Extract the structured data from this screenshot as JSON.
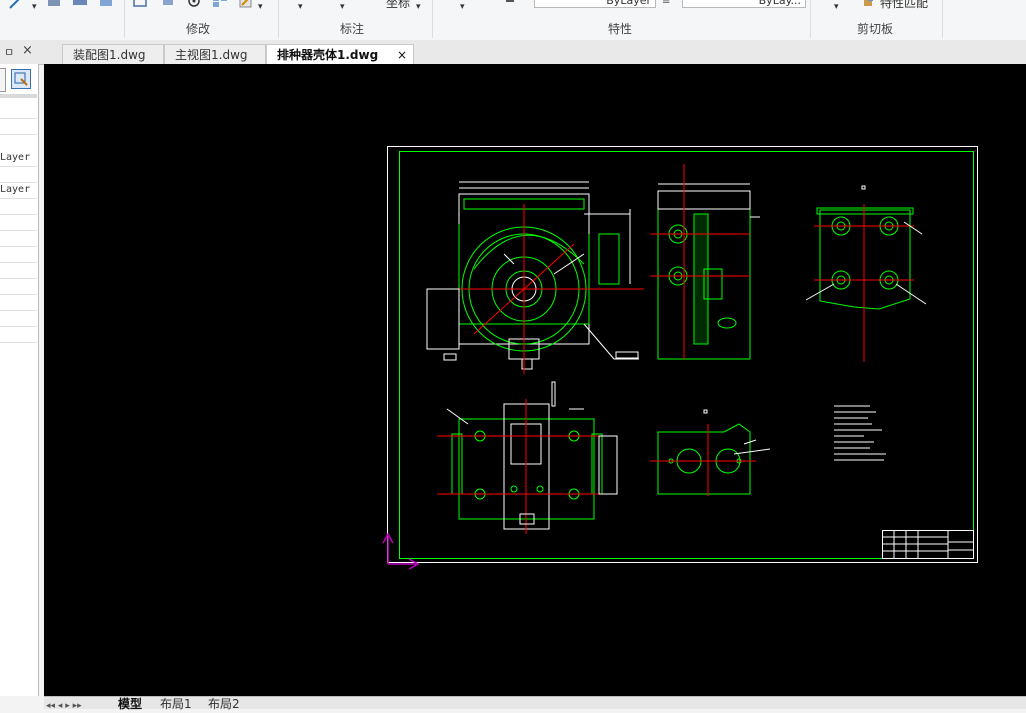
{
  "ribbon": {
    "groups": [
      {
        "label": "修改"
      },
      {
        "label": "标注"
      },
      {
        "label": "特性"
      },
      {
        "label": "剪切板"
      }
    ],
    "coord_label": "坐标",
    "layer_field_1": "ByLayer",
    "layer_field_2": "ByLay...",
    "match_label": "特性匹配"
  },
  "left_panel": {
    "pin_label": "ㅁ",
    "close_label": "×",
    "rows": [
      "",
      "",
      "Layer",
      "",
      "Layer",
      "",
      "",
      "",
      "",
      "",
      "",
      "",
      "",
      ""
    ]
  },
  "doc_tabs": [
    {
      "label": "装配图1.dwg",
      "active": false
    },
    {
      "label": "主视图1.dwg",
      "active": false
    },
    {
      "label": "排种器壳体1.dwg",
      "active": true
    }
  ],
  "tab_close": "×",
  "bottom_tabs": {
    "nav": "◂◂ ◂ ▸ ▸▸",
    "model": "模型",
    "layout1": "布局1",
    "layout2": "布局2"
  },
  "colors": {
    "canvas": "#000000",
    "drawing_line": "#00ff00",
    "white_line": "#ffffff",
    "center_line": "#ff0000",
    "ucs": "#c000c0"
  }
}
